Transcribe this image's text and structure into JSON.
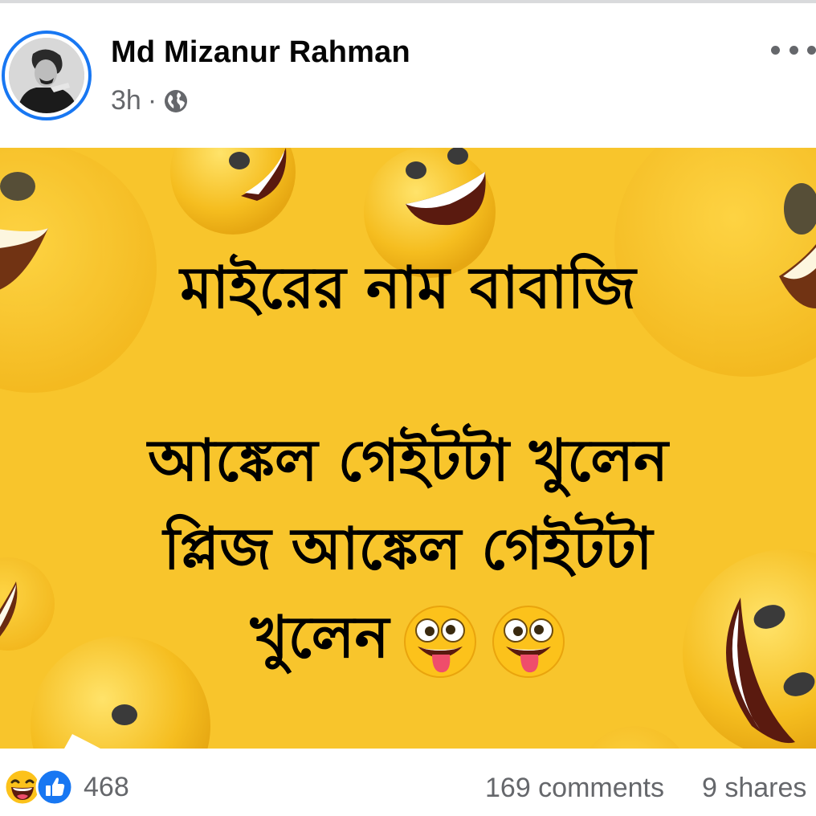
{
  "post": {
    "author": "Md Mizanur Rahman",
    "time": "3h",
    "separator": "·",
    "privacy_icon": "globe-icon",
    "menu_icon": "more-horizontal-icon"
  },
  "image": {
    "background_color": "#f8c52c",
    "text_lines": [
      "মাইরের নাম বাবাজি",
      "আঙ্কেল গেইটটা খুলেন",
      "প্লিজ আঙ্কেল গেইটটা",
      "খুলেন"
    ],
    "trailing_emoji": [
      "zany-face-emoji",
      "zany-face-emoji"
    ]
  },
  "footer": {
    "reaction_icons": [
      "haha-reaction-icon",
      "like-reaction-icon"
    ],
    "reaction_count": "468",
    "comments": "169 comments",
    "shares": "9 shares"
  },
  "colors": {
    "accent": "#1877f2",
    "secondary_text": "#65676b",
    "primary_text": "#050505"
  }
}
